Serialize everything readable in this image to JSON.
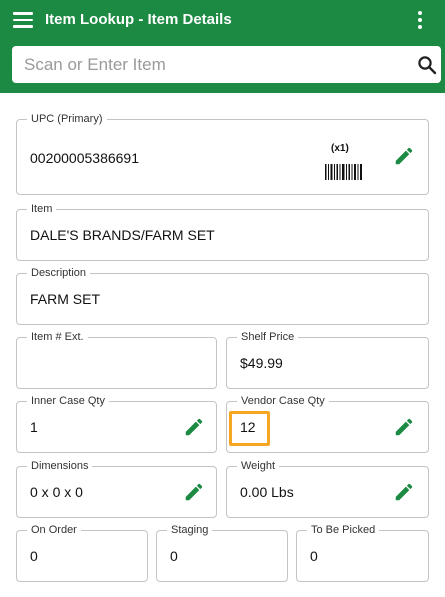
{
  "app": {
    "title": "Item Lookup - Item Details",
    "theme_color": "#1d8a43",
    "highlight_color": "#f5a623"
  },
  "search": {
    "placeholder": "Scan or Enter Item",
    "value": ""
  },
  "upc": {
    "label": "UPC (Primary)",
    "value": "00200005386691",
    "quantity_badge": "(x1)"
  },
  "item": {
    "label": "Item",
    "value": "DALE'S BRANDS/FARM SET"
  },
  "description": {
    "label": "Description",
    "value": "FARM SET"
  },
  "item_ext": {
    "label": "Item # Ext.",
    "value": ""
  },
  "shelf_price": {
    "label": "Shelf Price",
    "value": "$49.99"
  },
  "inner_case_qty": {
    "label": "Inner Case Qty",
    "value": "1"
  },
  "vendor_case_qty": {
    "label": "Vendor Case Qty",
    "value": "12"
  },
  "dimensions": {
    "label": "Dimensions",
    "value": "0 x 0 x 0"
  },
  "weight": {
    "label": "Weight",
    "value": "0.00 Lbs"
  },
  "on_order": {
    "label": "On Order",
    "value": "0"
  },
  "staging": {
    "label": "Staging",
    "value": "0"
  },
  "to_be_picked": {
    "label": "To Be Picked",
    "value": "0"
  },
  "icons": {
    "menu": "hamburger-menu-icon",
    "more": "more-vertical-icon",
    "search": "search-icon",
    "edit": "pencil-icon",
    "barcode": "barcode-icon"
  }
}
